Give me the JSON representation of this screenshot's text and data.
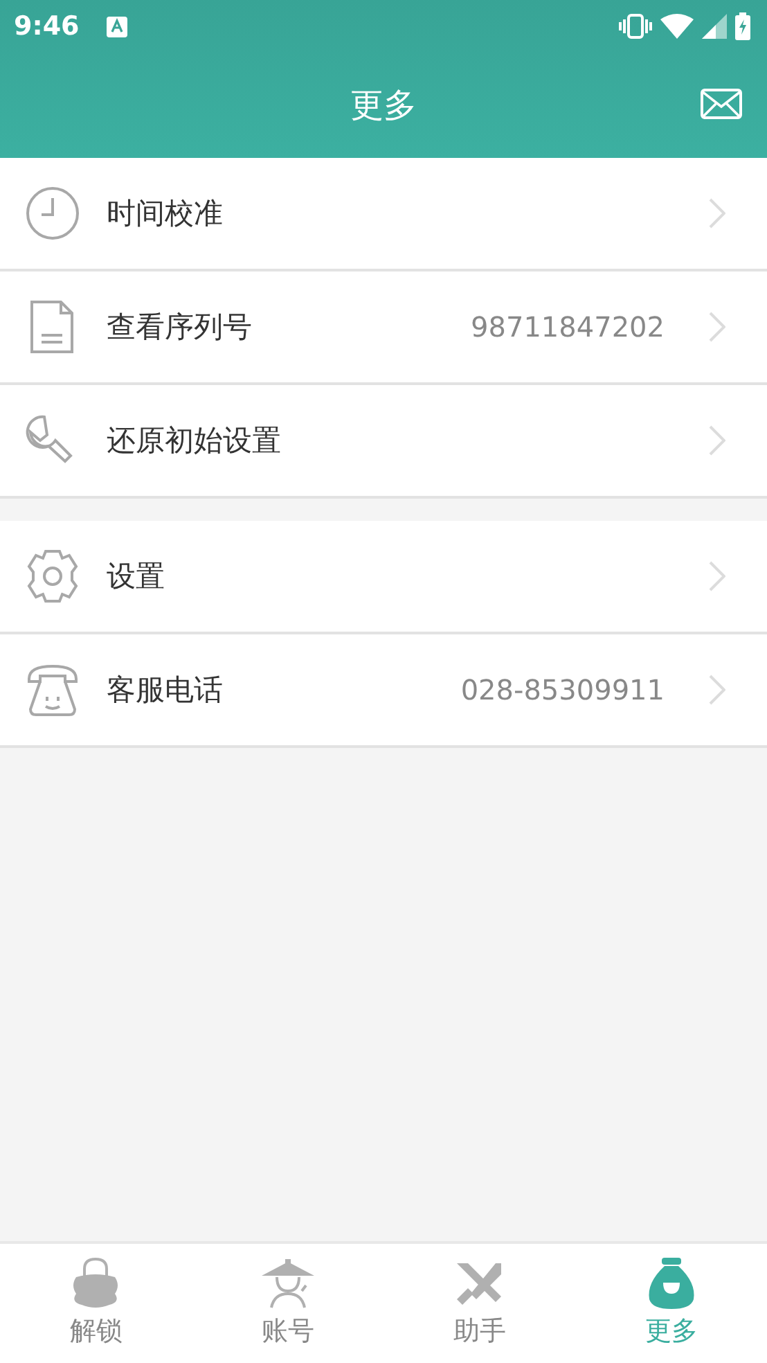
{
  "status_bar": {
    "time": "9:46"
  },
  "header": {
    "title": "更多"
  },
  "sections": [
    {
      "items": [
        {
          "label": "时间校准"
        },
        {
          "label": "查看序列号",
          "value": "98711847202"
        },
        {
          "label": "还原初始设置"
        }
      ]
    },
    {
      "items": [
        {
          "label": "设置"
        },
        {
          "label": "客服电话",
          "value": "028-85309911"
        }
      ]
    }
  ],
  "tabs": [
    {
      "label": "解锁",
      "selected": false
    },
    {
      "label": "账号",
      "selected": false
    },
    {
      "label": "助手",
      "selected": false
    },
    {
      "label": "更多",
      "selected": true
    }
  ]
}
